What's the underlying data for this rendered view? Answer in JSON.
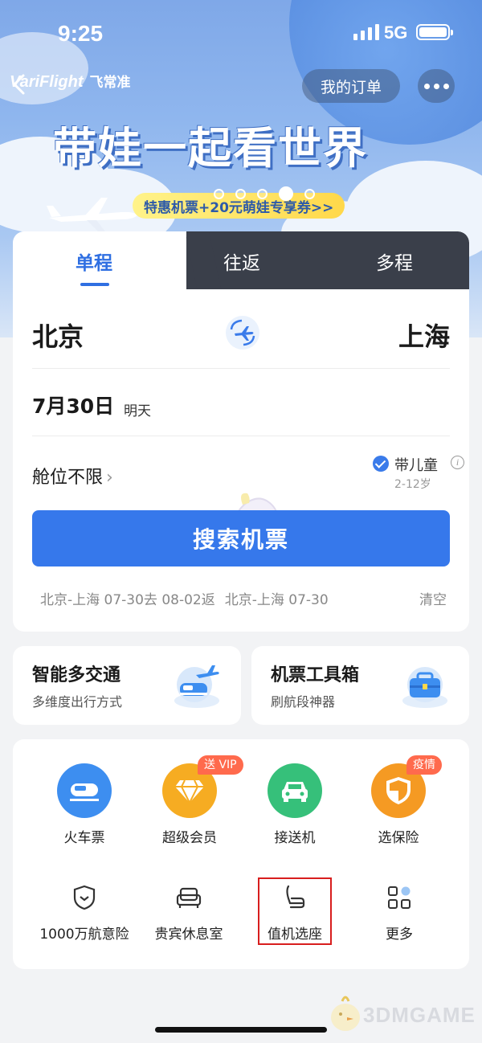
{
  "status_bar": {
    "time": "9:25",
    "network": "5G"
  },
  "header": {
    "logo_en": "VariFlight",
    "logo_cn": "飞常准",
    "orders_label": "我的订单"
  },
  "banner": {
    "headline": "带娃一起看世界",
    "promo": "特惠机票+20元萌娃专享券>>",
    "slide_count": 5,
    "active_slide": 4
  },
  "tabs": [
    {
      "label": "单程",
      "active": true
    },
    {
      "label": "往返"
    },
    {
      "label": "多程"
    }
  ],
  "search": {
    "from_city": "北京",
    "to_city": "上海",
    "date": "7月30日",
    "date_note": "明天",
    "cabin": "舱位不限",
    "child_label": "带儿童",
    "child_age": "2-12岁",
    "search_button": "搜索机票",
    "history": [
      "北京-上海 07-30去 08-02返",
      "北京-上海 07-30"
    ],
    "clear_label": "清空"
  },
  "features": [
    {
      "title": "智能多交通",
      "subtitle": "多维度出行方式",
      "icon": "train-plane-icon"
    },
    {
      "title": "机票工具箱",
      "subtitle": "刷航段神器",
      "icon": "toolbox-icon"
    }
  ],
  "services_row1": [
    {
      "label": "火车票",
      "icon": "train-icon",
      "color": "#3d8ef0"
    },
    {
      "label": "超级会员",
      "icon": "diamond-icon",
      "color": "#f6ac22",
      "badge": "送 VIP"
    },
    {
      "label": "接送机",
      "icon": "car-icon",
      "color": "#36c07a"
    },
    {
      "label": "选保险",
      "icon": "shield-icon",
      "color": "#f59a23",
      "badge": "疫情"
    }
  ],
  "services_row2": [
    {
      "label": "1000万航意险",
      "icon": "shield-heart-icon"
    },
    {
      "label": "贵宾休息室",
      "icon": "sofa-icon"
    },
    {
      "label": "值机选座",
      "icon": "seat-icon"
    },
    {
      "label": "更多",
      "icon": "grid-icon"
    }
  ],
  "watermark": "3DMGAME",
  "colors": {
    "primary": "#3678eb",
    "badge": "#ff6a4d",
    "highlight": "#d81e1e"
  }
}
